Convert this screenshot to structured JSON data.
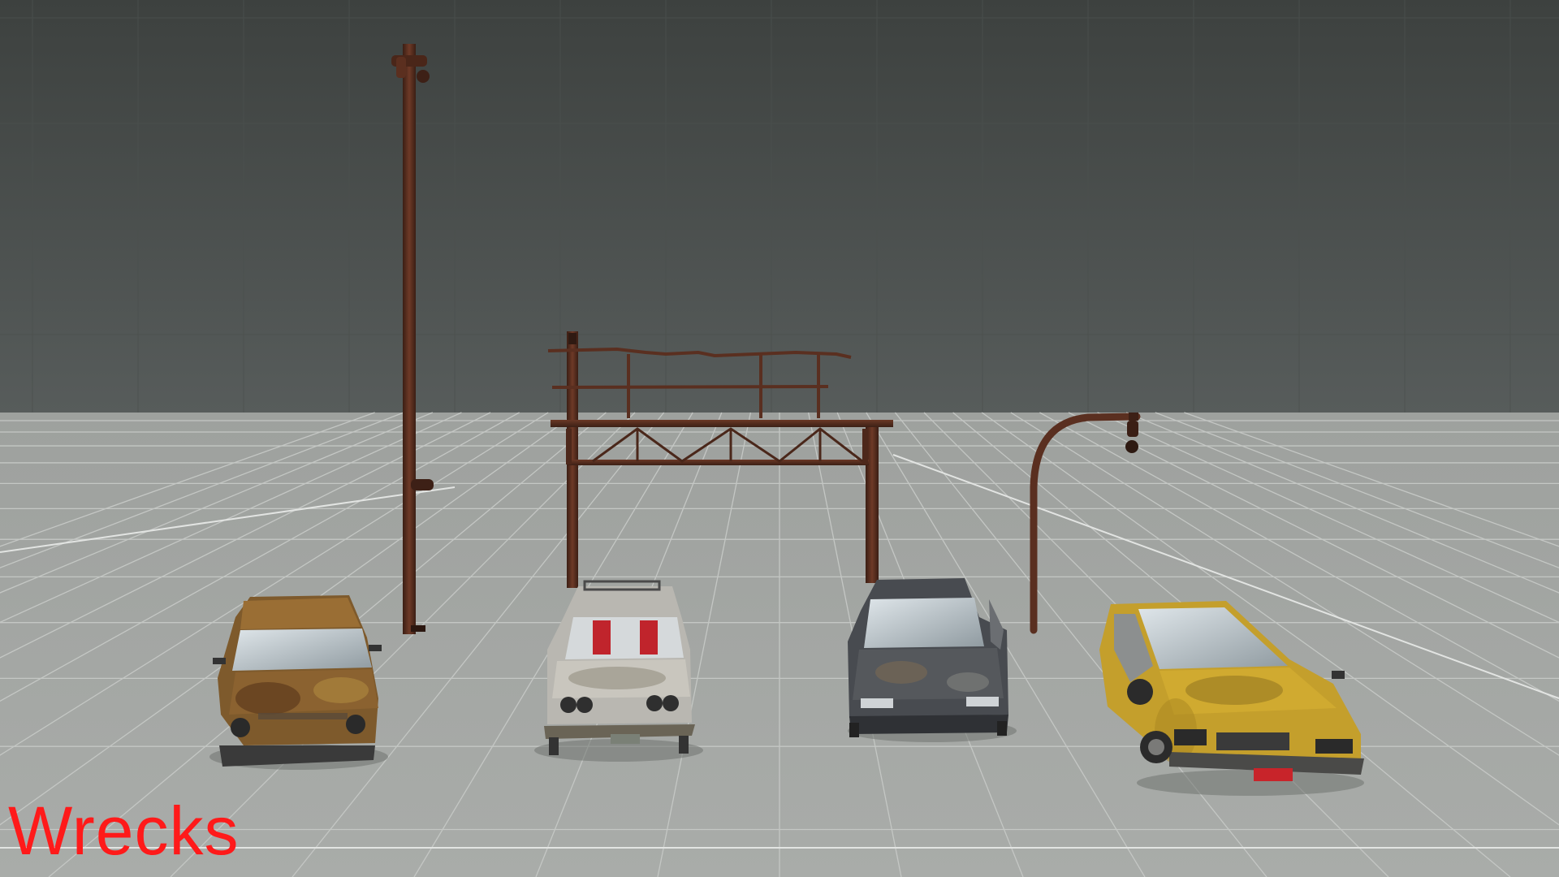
{
  "caption": "Wrecks",
  "colors": {
    "sky_top": "#3e4240",
    "sky_bottom": "#545958",
    "floor": "#a3a6a3",
    "grid": "#c7cac7",
    "caption": "#ff1a1a",
    "rust": "#5a2e1f"
  },
  "objects": [
    {
      "name": "utility-pole",
      "kind": "pole"
    },
    {
      "name": "overhead-sign-gantry",
      "kind": "gantry"
    },
    {
      "name": "curved-street-lamp",
      "kind": "lamp"
    },
    {
      "name": "rusted-hatchback-wreck",
      "kind": "car",
      "body_color": "#8a6a3a"
    },
    {
      "name": "white-sedan-wreck",
      "kind": "car",
      "body_color": "#bdbbb5"
    },
    {
      "name": "dark-sedan-wreck",
      "kind": "car",
      "body_color": "#4a4d52"
    },
    {
      "name": "yellow-coupe-wreck",
      "kind": "car",
      "body_color": "#c9a12a"
    }
  ]
}
